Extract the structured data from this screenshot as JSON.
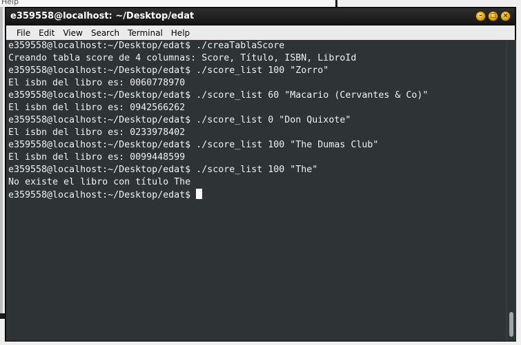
{
  "background": {
    "menu_fragment": "Help"
  },
  "window": {
    "title": "e359558@localhost: ~/Desktop/edat",
    "buttons": [
      "minimize",
      "maximize",
      "close"
    ]
  },
  "menu": [
    "File",
    "Edit",
    "View",
    "Search",
    "Terminal",
    "Help"
  ],
  "terminal": {
    "lines": [
      "e359558@localhost:~/Desktop/edat$ ./creaTablaScore",
      "Creando tabla score de 4 columnas: Score, Título, ISBN, LibroId",
      "e359558@localhost:~/Desktop/edat$ ./score_list 100 \"Zorro\"",
      "El isbn del libro es: 0060778970",
      "e359558@localhost:~/Desktop/edat$ ./score_list 60 \"Macario (Cervantes & Co)\"",
      "El isbn del libro es: 0942566262",
      "e359558@localhost:~/Desktop/edat$ ./score_list 0 \"Don Quixote\"",
      "El isbn del libro es: 0233978402",
      "e359558@localhost:~/Desktop/edat$ ./score_list 100 \"The Dumas Club\"",
      "El isbn del libro es: 0099448599",
      "e359558@localhost:~/Desktop/edat$ ./score_list 100 \"The\"",
      "No existe el libro con título The"
    ],
    "prompt": "e359558@localhost:~/Desktop/edat$ "
  },
  "colors": {
    "terminal_bg": "#2e3436",
    "terminal_fg": "#f0f0f0",
    "titlebar_bg": "#1c1c1c",
    "button_accent": "#e0a000"
  }
}
